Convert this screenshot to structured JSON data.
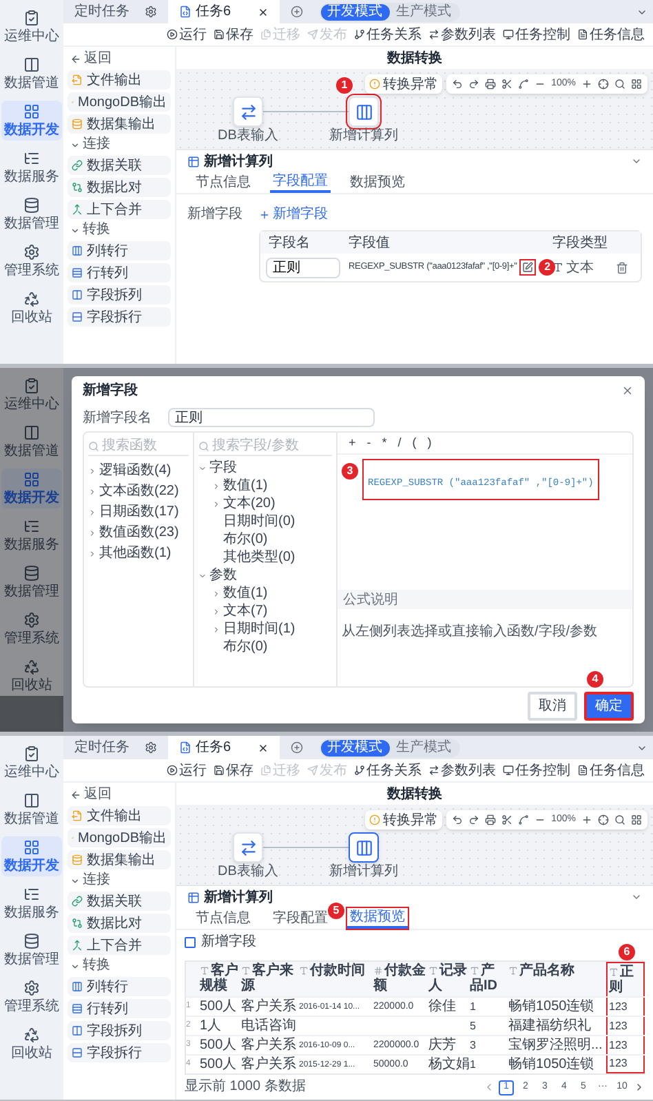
{
  "screens": [
    {
      "kind": "editor",
      "sidebar": [
        {
          "label": "运维中心",
          "selected": false
        },
        {
          "label": "数据管道",
          "selected": false
        },
        {
          "label": "数据开发",
          "selected": true
        },
        {
          "label": "数据服务",
          "selected": false
        },
        {
          "label": "数据管理",
          "selected": false
        },
        {
          "label": "管理系统",
          "selected": false
        },
        {
          "label": "回收站",
          "selected": false
        }
      ],
      "tabs": [
        {
          "label": "定时任务",
          "selected": false
        },
        {
          "label": "任务6",
          "selected": true
        }
      ],
      "modes": [
        {
          "label": "开发模式",
          "selected": true
        },
        {
          "label": "生产模式",
          "selected": false
        }
      ],
      "toolbar": [
        {
          "label": "运行",
          "disabled": false
        },
        {
          "label": "保存",
          "disabled": false
        },
        {
          "label": "迁移",
          "disabled": true
        },
        {
          "label": "发布",
          "disabled": true
        },
        {
          "label": "任务关系",
          "disabled": false
        },
        {
          "label": "参数列表",
          "disabled": false
        },
        {
          "label": "任务控制",
          "disabled": false
        },
        {
          "label": "任务信息",
          "disabled": false
        }
      ],
      "back": "返回",
      "title": "数据转换",
      "components": [
        {
          "kind": "item",
          "label": "文件输出"
        },
        {
          "kind": "item",
          "label": "MongoDB输出"
        },
        {
          "kind": "item",
          "label": "数据集输出"
        },
        {
          "kind": "section",
          "label": "连接",
          "expanded": true
        },
        {
          "kind": "item",
          "label": "数据关联"
        },
        {
          "kind": "item",
          "label": "数据比对"
        },
        {
          "kind": "item",
          "label": "上下合并"
        },
        {
          "kind": "section",
          "label": "转换",
          "expanded": true
        },
        {
          "kind": "item",
          "label": "列转行"
        },
        {
          "kind": "item",
          "label": "行转列"
        },
        {
          "kind": "item",
          "label": "字段拆列"
        },
        {
          "kind": "item",
          "label": "字段拆行"
        }
      ],
      "canvas": {
        "badge": "转换异常",
        "zoom": "100%",
        "nodes": [
          {
            "kind": "source",
            "label": "DB表输入",
            "selected": false,
            "highlighted": false
          },
          {
            "kind": "transform",
            "label": "新增计算列",
            "selected": false,
            "highlighted": true,
            "marker": "1"
          }
        ]
      },
      "panel": {
        "title": "新增计算列",
        "tabs": [
          {
            "label": "节点信息",
            "selected": false,
            "highlighted": false
          },
          {
            "label": "字段配置",
            "selected": true,
            "highlighted": false
          },
          {
            "label": "数据预览",
            "selected": false,
            "highlighted": false
          }
        ],
        "content": {
          "kind": "field_config",
          "label": "新增字段",
          "add": "新增字段",
          "columns": [
            "字段名",
            "字段值",
            "字段类型"
          ],
          "rows": [
            {
              "name": "正则",
              "value": "REGEXP_SUBSTR (\"aaa0123fafaf\" ,\"[0-9]+\"",
              "edit_highlighted": true,
              "edit_marker": "2",
              "type": "文本"
            }
          ]
        }
      }
    },
    {
      "kind": "dialog",
      "sidebar": [
        {
          "label": "运维中心",
          "selected": false
        },
        {
          "label": "数据管道",
          "selected": false
        },
        {
          "label": "数据开发",
          "selected": true
        },
        {
          "label": "数据服务",
          "selected": false
        },
        {
          "label": "数据管理",
          "selected": false
        },
        {
          "label": "管理系统",
          "selected": false
        },
        {
          "label": "回收站",
          "selected": false
        }
      ],
      "dialog": {
        "title": "新增字段",
        "name_label": "新增字段名",
        "name_value": "正则",
        "function_search": {
          "placeholder": "搜索函数"
        },
        "functions": [
          {
            "label": "逻辑函数(4)"
          },
          {
            "label": "文本函数(22)"
          },
          {
            "label": "日期函数(17)"
          },
          {
            "label": "数值函数(23)"
          },
          {
            "label": "其他函数(1)"
          }
        ],
        "field_search": {
          "placeholder": "搜索字段/参数"
        },
        "tree": [
          {
            "label": "字段",
            "expanded": true,
            "children": [
              {
                "label": "数值(1)",
                "expandable": true
              },
              {
                "label": "文本(20)",
                "expandable": true
              },
              {
                "label": "日期时间(0)",
                "expandable": false
              },
              {
                "label": "布尔(0)",
                "expandable": false
              },
              {
                "label": "其他类型(0)",
                "expandable": false
              }
            ]
          },
          {
            "label": "参数",
            "expanded": true,
            "children": [
              {
                "label": "数值(1)",
                "expandable": true
              },
              {
                "label": "文本(7)",
                "expandable": true
              },
              {
                "label": "日期时间(1)",
                "expandable": true
              },
              {
                "label": "布尔(0)",
                "expandable": false
              }
            ]
          }
        ],
        "operators": [
          "+",
          "-",
          "*",
          "/",
          "(",
          ")"
        ],
        "formula": "REGEXP_SUBSTR (\"aaa123fafaf\" ,\"[0-9]+\")",
        "formula_highlighted": true,
        "formula_marker": "3",
        "help_title": "公式说明",
        "help_text": "从左侧列表选择或直接输入函数/字段/参数",
        "buttons": [
          {
            "kind": "secondary",
            "label": "取消",
            "highlighted": false
          },
          {
            "kind": "primary",
            "label": "确定",
            "highlighted": true,
            "marker": "4"
          }
        ]
      }
    },
    {
      "kind": "editor",
      "sidebar": [
        {
          "label": "运维中心",
          "selected": false
        },
        {
          "label": "数据管道",
          "selected": false
        },
        {
          "label": "数据开发",
          "selected": true
        },
        {
          "label": "数据服务",
          "selected": false
        },
        {
          "label": "数据管理",
          "selected": false
        },
        {
          "label": "管理系统",
          "selected": false
        },
        {
          "label": "回收站",
          "selected": false
        }
      ],
      "tabs": [
        {
          "label": "定时任务",
          "selected": false
        },
        {
          "label": "任务6",
          "selected": true
        }
      ],
      "modes": [
        {
          "label": "开发模式",
          "selected": true
        },
        {
          "label": "生产模式",
          "selected": false
        }
      ],
      "toolbar": [
        {
          "label": "运行",
          "disabled": false
        },
        {
          "label": "保存",
          "disabled": false
        },
        {
          "label": "迁移",
          "disabled": true
        },
        {
          "label": "发布",
          "disabled": true
        },
        {
          "label": "任务关系",
          "disabled": false
        },
        {
          "label": "参数列表",
          "disabled": false
        },
        {
          "label": "任务控制",
          "disabled": false
        },
        {
          "label": "任务信息",
          "disabled": false
        }
      ],
      "back": "返回",
      "title": "数据转换",
      "components": [
        {
          "kind": "item",
          "label": "文件输出"
        },
        {
          "kind": "item",
          "label": "MongoDB输出"
        },
        {
          "kind": "item",
          "label": "数据集输出"
        },
        {
          "kind": "section",
          "label": "连接",
          "expanded": true
        },
        {
          "kind": "item",
          "label": "数据关联"
        },
        {
          "kind": "item",
          "label": "数据比对"
        },
        {
          "kind": "item",
          "label": "上下合并"
        },
        {
          "kind": "section",
          "label": "转换",
          "expanded": true
        },
        {
          "kind": "item",
          "label": "列转行"
        },
        {
          "kind": "item",
          "label": "行转列"
        },
        {
          "kind": "item",
          "label": "字段拆列"
        },
        {
          "kind": "item",
          "label": "字段拆行"
        }
      ],
      "canvas": {
        "badge": "转换异常",
        "zoom": "100%",
        "nodes": [
          {
            "kind": "source",
            "label": "DB表输入",
            "selected": false,
            "highlighted": false
          },
          {
            "kind": "transform",
            "label": "新增计算列",
            "selected": true,
            "highlighted": false
          }
        ]
      },
      "panel": {
        "title": "新增计算列",
        "tabs": [
          {
            "label": "节点信息",
            "selected": false,
            "highlighted": false
          },
          {
            "label": "字段配置",
            "selected": false,
            "highlighted": false
          },
          {
            "label": "数据预览",
            "selected": true,
            "highlighted": true,
            "marker": "5"
          }
        ],
        "content": {
          "kind": "preview",
          "checkbox": {
            "label": "新增字段",
            "checked": false
          },
          "columns": [
            {
              "label": "客户规模",
              "kind": "text",
              "highlighted": false
            },
            {
              "label": "客户来源",
              "kind": "text",
              "highlighted": false
            },
            {
              "label": "付款时间",
              "kind": "text",
              "highlighted": false
            },
            {
              "label": "付款金额",
              "kind": "number",
              "highlighted": false
            },
            {
              "label": "记录人",
              "kind": "text",
              "highlighted": false
            },
            {
              "label": "产品ID",
              "kind": "text",
              "highlighted": false
            },
            {
              "label": "产品名称",
              "kind": "text",
              "highlighted": false
            },
            {
              "label": "正则",
              "kind": "text",
              "highlighted": true,
              "marker": "6"
            }
          ],
          "rows": [
            {
              "index": "1",
              "cells": [
                "500人",
                "客户关系",
                "2016-01-14 10...",
                "220000.0",
                "徐佳",
                "1",
                "畅销1050连锁",
                "123"
              ]
            },
            {
              "index": "2",
              "cells": [
                "1人",
                "电话咨询",
                null,
                null,
                null,
                "5",
                "福建福纺织礼",
                "123"
              ]
            },
            {
              "index": "3",
              "cells": [
                "500人",
                "客户关系",
                "2016-10-09 0...",
                "2200000.0",
                "庆芳",
                "3",
                "宝钢罗泾照明...",
                "123"
              ]
            },
            {
              "index": "4",
              "cells": [
                "500人",
                "客户关系",
                "2015-12-29 1...",
                "50000.0",
                "杨文娟",
                "1",
                "畅销1050连锁",
                "123"
              ]
            }
          ],
          "footer": "显示前 1000 条数据",
          "pages": [
            {
              "label": "1",
              "selected": true
            },
            {
              "label": "2",
              "selected": false
            },
            {
              "label": "3",
              "selected": false
            },
            {
              "label": "4",
              "selected": false
            },
            {
              "label": "5",
              "selected": false
            },
            {
              "label": "···",
              "selected": false
            },
            {
              "label": "10",
              "selected": false
            }
          ]
        }
      }
    }
  ]
}
